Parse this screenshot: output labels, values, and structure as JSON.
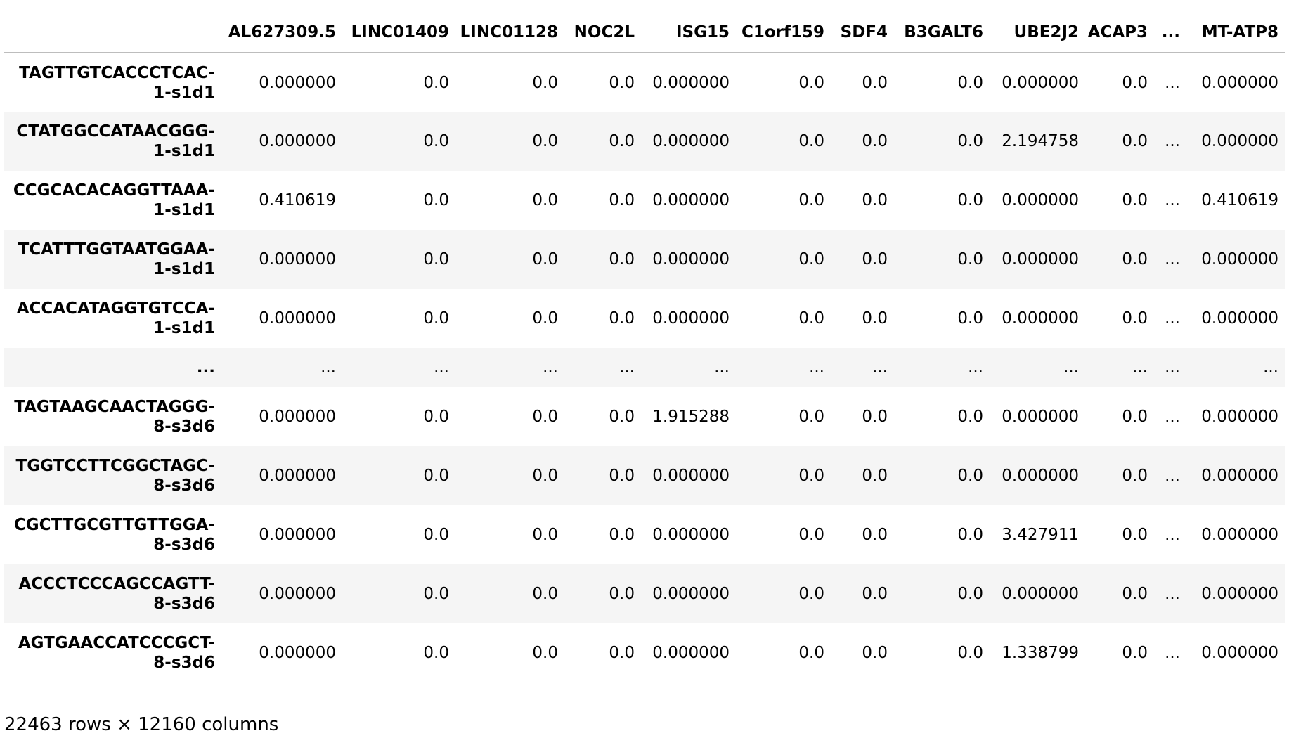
{
  "table": {
    "index_header": "",
    "columns": [
      "AL627309.5",
      "LINC01409",
      "LINC01128",
      "NOC2L",
      "ISG15",
      "C1orf159",
      "SDF4",
      "B3GALT6",
      "UBE2J2",
      "ACAP3",
      "...",
      "MT-ATP8"
    ],
    "rows": [
      {
        "index": "TAGTTGTCACCCTCAC-1-s1d1",
        "cells": [
          "0.000000",
          "0.0",
          "0.0",
          "0.0",
          "0.000000",
          "0.0",
          "0.0",
          "0.0",
          "0.000000",
          "0.0",
          "...",
          "0.000000"
        ]
      },
      {
        "index": "CTATGGCCATAACGGG-1-s1d1",
        "cells": [
          "0.000000",
          "0.0",
          "0.0",
          "0.0",
          "0.000000",
          "0.0",
          "0.0",
          "0.0",
          "2.194758",
          "0.0",
          "...",
          "0.000000"
        ]
      },
      {
        "index": "CCGCACACAGGTTAAA-1-s1d1",
        "cells": [
          "0.410619",
          "0.0",
          "0.0",
          "0.0",
          "0.000000",
          "0.0",
          "0.0",
          "0.0",
          "0.000000",
          "0.0",
          "...",
          "0.410619"
        ]
      },
      {
        "index": "TCATTTGGTAATGGAA-1-s1d1",
        "cells": [
          "0.000000",
          "0.0",
          "0.0",
          "0.0",
          "0.000000",
          "0.0",
          "0.0",
          "0.0",
          "0.000000",
          "0.0",
          "...",
          "0.000000"
        ]
      },
      {
        "index": "ACCACATAGGTGTCCA-1-s1d1",
        "cells": [
          "0.000000",
          "0.0",
          "0.0",
          "0.0",
          "0.000000",
          "0.0",
          "0.0",
          "0.0",
          "0.000000",
          "0.0",
          "...",
          "0.000000"
        ]
      },
      {
        "index": "...",
        "cells": [
          "...",
          "...",
          "...",
          "...",
          "...",
          "...",
          "...",
          "...",
          "...",
          "...",
          "...",
          "..."
        ]
      },
      {
        "index": "TAGTAAGCAACTAGGG-8-s3d6",
        "cells": [
          "0.000000",
          "0.0",
          "0.0",
          "0.0",
          "1.915288",
          "0.0",
          "0.0",
          "0.0",
          "0.000000",
          "0.0",
          "...",
          "0.000000"
        ]
      },
      {
        "index": "TGGTCCTTCGGCTAGC-8-s3d6",
        "cells": [
          "0.000000",
          "0.0",
          "0.0",
          "0.0",
          "0.000000",
          "0.0",
          "0.0",
          "0.0",
          "0.000000",
          "0.0",
          "...",
          "0.000000"
        ]
      },
      {
        "index": "CGCTTGCGTTGTTGGA-8-s3d6",
        "cells": [
          "0.000000",
          "0.0",
          "0.0",
          "0.0",
          "0.000000",
          "0.0",
          "0.0",
          "0.0",
          "3.427911",
          "0.0",
          "...",
          "0.000000"
        ]
      },
      {
        "index": "ACCCTCCCAGCCAGTT-8-s3d6",
        "cells": [
          "0.000000",
          "0.0",
          "0.0",
          "0.0",
          "0.000000",
          "0.0",
          "0.0",
          "0.0",
          "0.000000",
          "0.0",
          "...",
          "0.000000"
        ]
      },
      {
        "index": "AGTGAACCATCCCGCT-8-s3d6",
        "cells": [
          "0.000000",
          "0.0",
          "0.0",
          "0.0",
          "0.000000",
          "0.0",
          "0.0",
          "0.0",
          "1.338799",
          "0.0",
          "...",
          "0.000000"
        ]
      }
    ]
  },
  "footer": {
    "shape_text": "22463 rows × 12160 columns"
  },
  "colors": {
    "row_shade": "#f5f5f5",
    "header_rule": "#bdbdbd"
  }
}
